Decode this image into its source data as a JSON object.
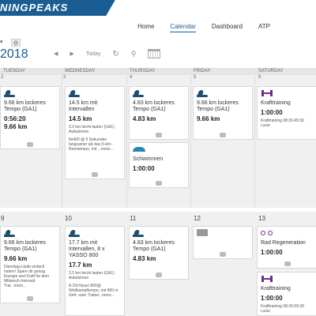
{
  "brand": {
    "name": "NINGPEAKS"
  },
  "nav": {
    "items": [
      "Home",
      "Calendar",
      "Dashboard",
      "ATP"
    ],
    "active": "Calendar"
  },
  "header": {
    "year": "2018"
  },
  "toolbar": {
    "today": "Today"
  },
  "weekdays": [
    "TUESDAY",
    "WEDNESDAY",
    "THURSDAY",
    "FRIDAY",
    "SATURDAY"
  ],
  "week1": {
    "days": [
      "2",
      "3",
      "4",
      "5",
      "6"
    ],
    "cards": {
      "tue": {
        "title": "9.66 km lockeres Tempo (GA1)",
        "time": "0:56:20",
        "distance": "9.66 km"
      },
      "wed": {
        "title": "14.5 km mit Intervallen",
        "distance": "14.5 km",
        "desc1": "3.2 km leicht laufen (GA1) Aufwärmen",
        "desc2": "8x400 @ 5 Sekunden langsamer als das 5-km-Renntempo, mit ...more..."
      },
      "thu": {
        "title": "4.83 km lockeres Tempo (GA1)",
        "distance": "4.83 km"
      },
      "thu2": {
        "title": "Schwimmen",
        "time": "1:00:00"
      },
      "fri": {
        "title": "9.66 km lockeres Tempo (GA1)",
        "distance": "9.66 km"
      },
      "sat": {
        "title": "Krafttraining",
        "time": "1:00:00",
        "desc": "Krafttraining 08:30-09:30 Lucie"
      }
    }
  },
  "week2": {
    "days": [
      "9",
      "10",
      "11",
      "12",
      "13"
    ],
    "cards": {
      "tue": {
        "title": "9.66 km lockeres Tempo (GA1)",
        "distance": "9.66 km",
        "desc": "Dienstag-Läufe einfach halten! Spare dir genug Energie und Kraft für dein Mittwoch-Intervall-Trai...more..."
      },
      "wed": {
        "title": "17.7 km mit Intervallen, 8 x YASSO 800",
        "distance": "17.7 km",
        "desc1": "3.2 km leicht laufen (GA1) Aufwärmen",
        "desc2": "8-10xYasso 800@ Wettkampftempo, mit 400 m Geh- oder Traber...more..."
      },
      "thu": {
        "title": "4.83 km lockeres Tempo (GA1)",
        "distance": "4.83 km"
      },
      "sat": {
        "title": "Rad Regeneration",
        "time": "1:00:00"
      },
      "sat2": {
        "title": "Krafttraining",
        "time": "1:00:00",
        "desc": "Krafttraining 08:30-09:30 Lucie"
      }
    }
  },
  "colors": {
    "brand": "#1a5d93",
    "run": "#1d4f6f",
    "swim": "#2a86b3",
    "strength": "#6b2d91"
  }
}
